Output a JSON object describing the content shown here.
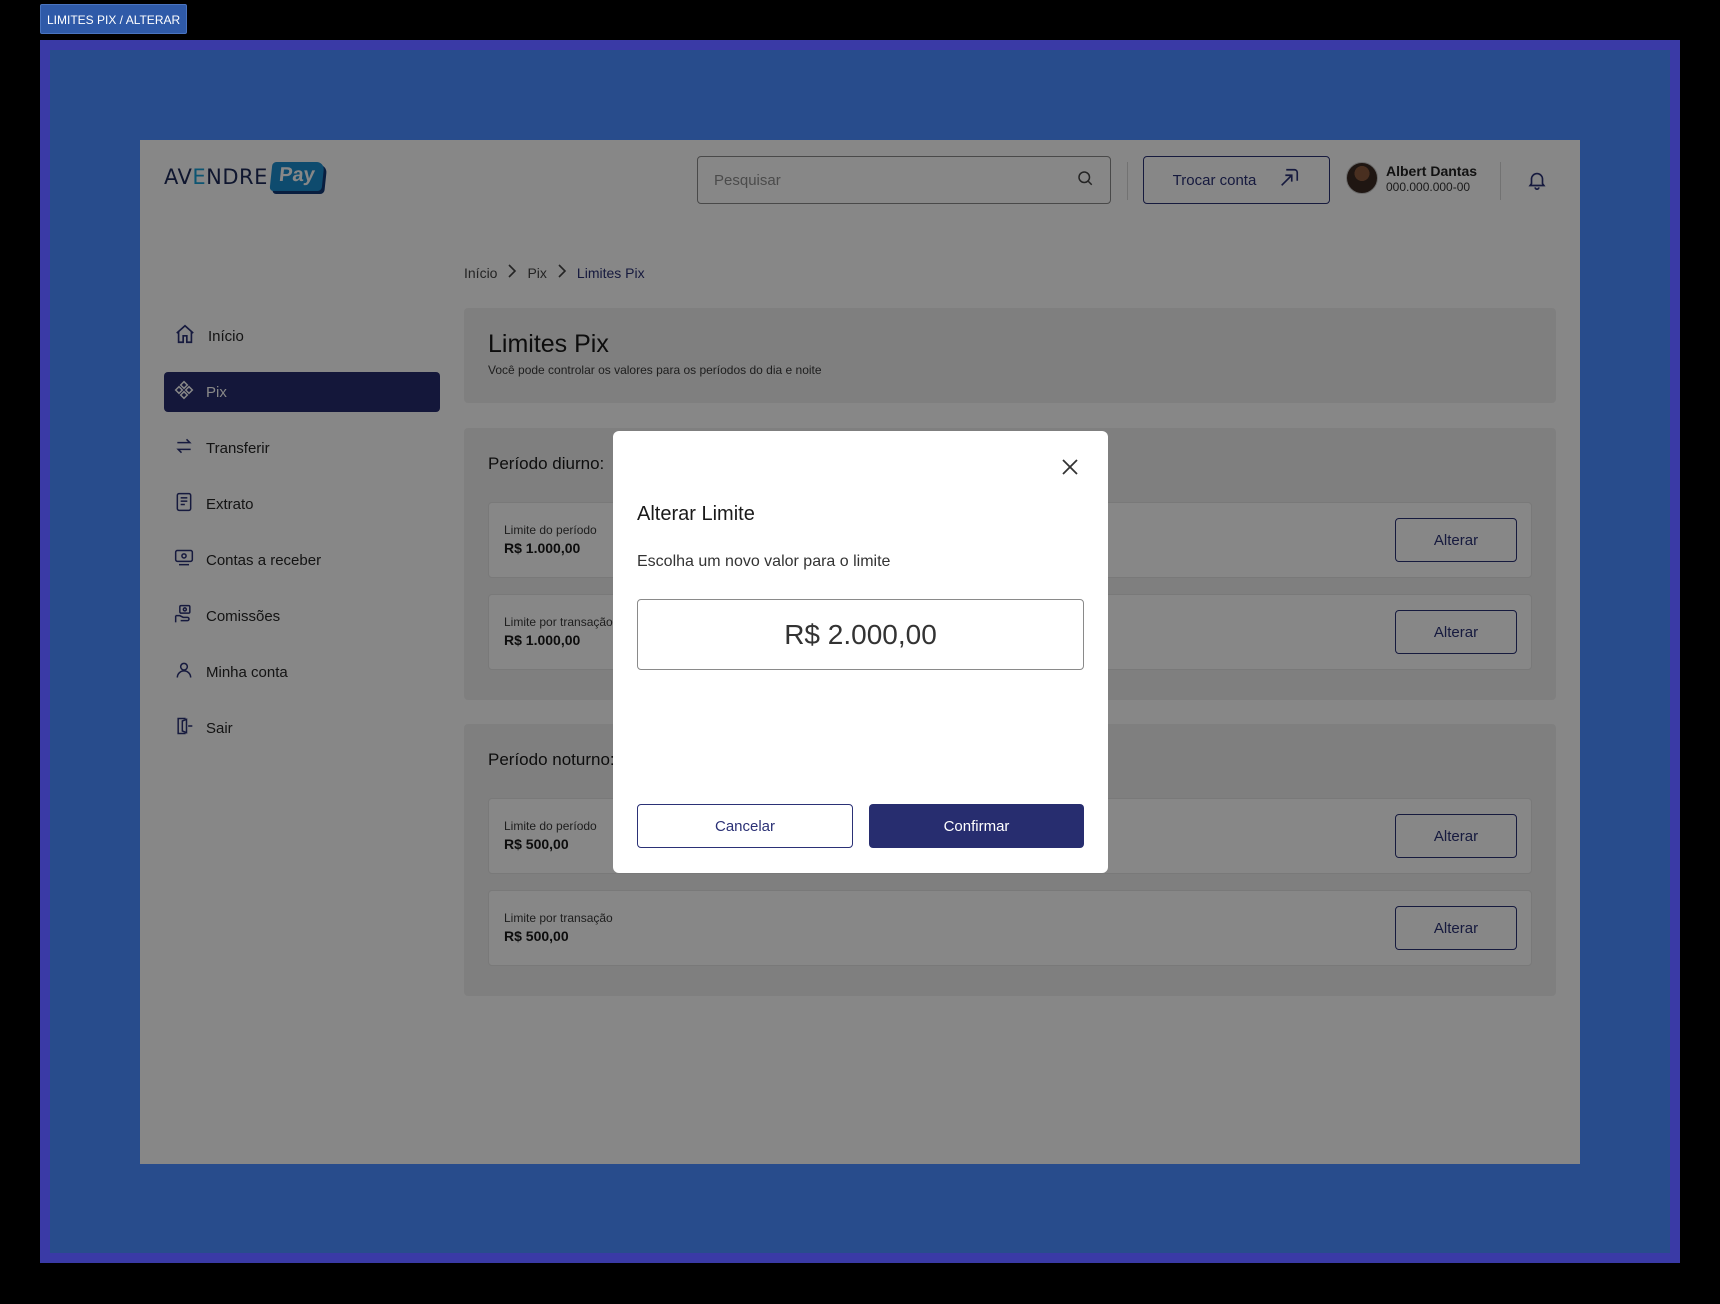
{
  "frame_label": "LIMITES PIX / ALTERAR",
  "header": {
    "logo_text_a": "AV",
    "logo_text_e": "E",
    "logo_text_b": "NDRE",
    "logo_pay": "Pay",
    "search_placeholder": "Pesquisar",
    "switch_account_label": "Trocar conta",
    "user_name": "Albert Dantas",
    "user_document": "000.000.000-00"
  },
  "sidebar": {
    "items": [
      {
        "label": "Início",
        "icon": "home-icon",
        "active": false
      },
      {
        "label": "Pix",
        "icon": "pix-icon",
        "active": true
      },
      {
        "label": "Transferir",
        "icon": "transfer-arrows-icon",
        "active": false
      },
      {
        "label": "Extrato",
        "icon": "statement-icon",
        "active": false
      },
      {
        "label": "Contas a receber",
        "icon": "receivables-icon",
        "active": false
      },
      {
        "label": "Comissões",
        "icon": "commission-icon",
        "active": false
      },
      {
        "label": "Minha conta",
        "icon": "user-icon",
        "active": false
      },
      {
        "label": "Sair",
        "icon": "logout-icon",
        "active": false
      }
    ]
  },
  "breadcrumb": [
    "Início",
    "Pix",
    "Limites Pix"
  ],
  "page": {
    "title": "Limites Pix",
    "subtitle": "Você pode controlar os valores para os períodos do dia e noite"
  },
  "periods": [
    {
      "title": "Período diurno:",
      "rows": [
        {
          "label": "Limite do período",
          "value": "R$ 1.000,00",
          "button": "Alterar"
        },
        {
          "label": "Limite por transação",
          "value": "R$ 1.000,00",
          "button": "Alterar"
        }
      ]
    },
    {
      "title": "Período noturno:",
      "rows": [
        {
          "label": "Limite do período",
          "value": "R$ 500,00",
          "button": "Alterar"
        },
        {
          "label": "Limite por transação",
          "value": "R$ 500,00",
          "button": "Alterar"
        }
      ]
    }
  ],
  "modal": {
    "title": "Alterar Limite",
    "subtitle": "Escolha um novo valor para o limite",
    "input_value": "R$ 2.000,00",
    "cancel_label": "Cancelar",
    "confirm_label": "Confirmar"
  },
  "colors": {
    "primary": "#272d6f",
    "logo_blue": "#1b8fd0",
    "frame_blue": "#284c8c"
  }
}
